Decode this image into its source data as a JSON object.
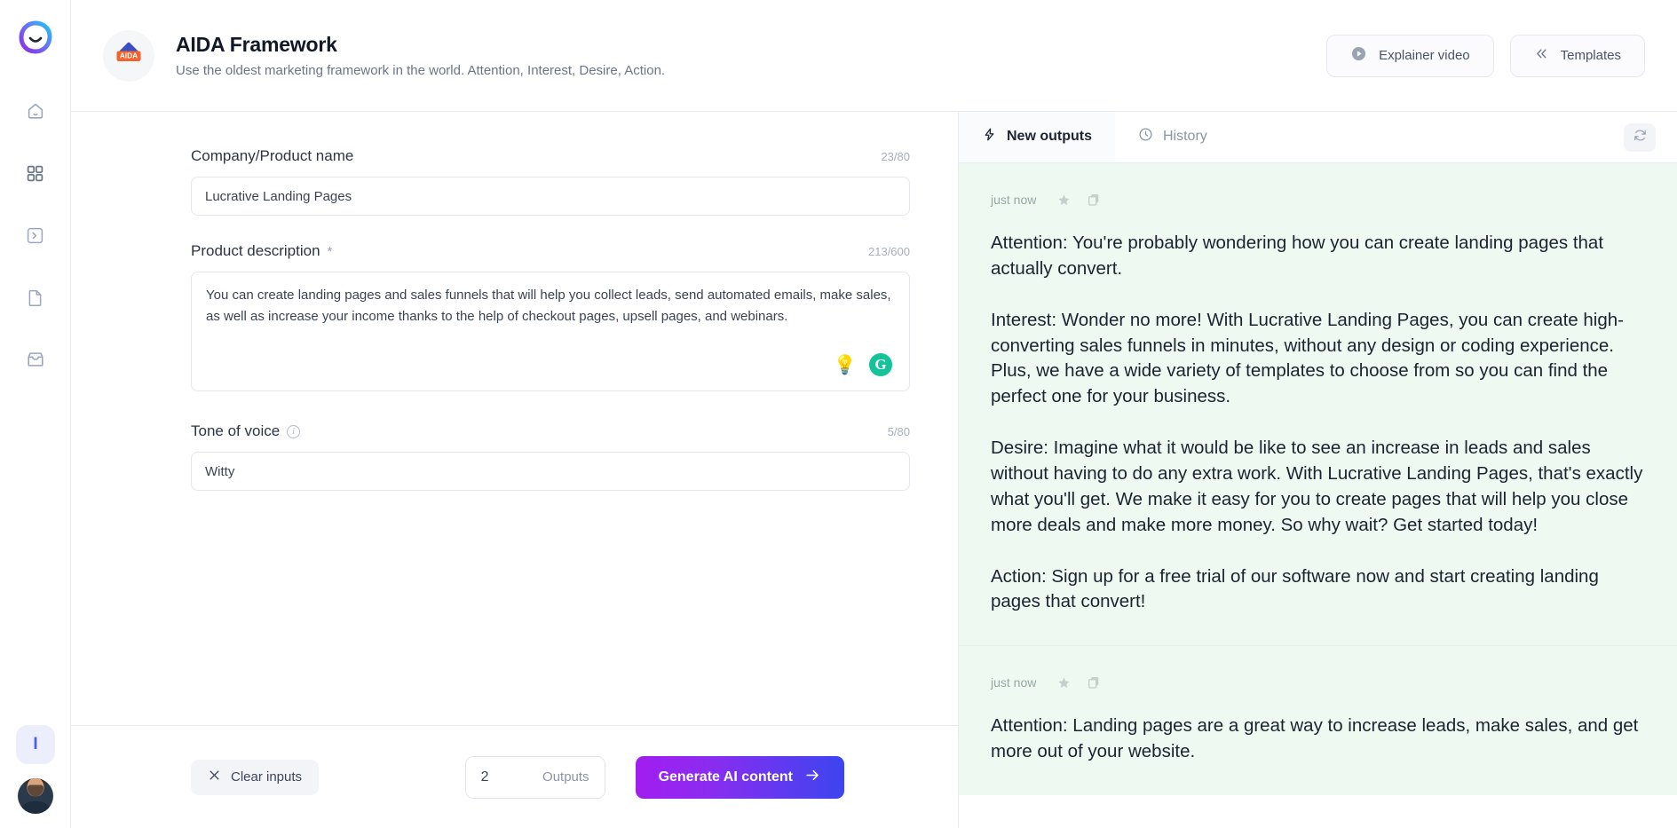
{
  "sidebar": {
    "logo_name": "app-logo",
    "items": [
      {
        "name": "home",
        "icon": "home-icon"
      },
      {
        "name": "apps",
        "icon": "grid-icon"
      },
      {
        "name": "console",
        "icon": "terminal-icon"
      },
      {
        "name": "documents",
        "icon": "document-icon"
      },
      {
        "name": "inbox",
        "icon": "inbox-icon"
      }
    ],
    "badge_label": "I",
    "avatar_name": "user-avatar"
  },
  "header": {
    "template_icon_label": "AIDA",
    "title": "AIDA Framework",
    "subtitle": "Use the oldest marketing framework in the world. Attention, Interest, Desire, Action.",
    "explainer_label": "Explainer video",
    "templates_label": "Templates"
  },
  "form": {
    "fields": [
      {
        "label": "Company/Product name",
        "required": false,
        "counter": "23/80",
        "value": "Lucrative Landing Pages",
        "placeholder": "Company/Product name"
      },
      {
        "label": "Product description",
        "required": true,
        "required_mark": "*",
        "counter": "213/600",
        "value": "You can create landing pages and sales funnels that will help you collect leads, send automated emails, make sales, as well as increase your income thanks to the help of checkout pages, upsell pages, and webinars.",
        "placeholder": "Product description"
      },
      {
        "label": "Tone of voice",
        "required": false,
        "has_info": true,
        "counter": "5/80",
        "value": "Witty",
        "placeholder": "Tone of voice"
      }
    ],
    "footer": {
      "clear_label": "Clear inputs",
      "outputs_count": "2",
      "outputs_label": "Outputs",
      "generate_label": "Generate AI content"
    }
  },
  "outputs": {
    "tabs": [
      {
        "label": "New outputs",
        "icon": "lightning-icon",
        "active": true
      },
      {
        "label": "History",
        "icon": "clock-icon",
        "active": false
      }
    ],
    "refresh_icon": "refresh-icon",
    "cards": [
      {
        "time": "just now",
        "text": "Attention: You're probably wondering how you can create landing pages that actually convert.\n\nInterest: Wonder no more! With Lucrative Landing Pages, you can create high-converting sales funnels in minutes, without any design or coding experience. Plus, we have a wide variety of templates to choose from so you can find the perfect one for your business.\n\nDesire: Imagine what it would be like to see an increase in leads and sales without having to do any extra work. With Lucrative Landing Pages, that's exactly what you'll get. We make it easy for you to create pages that will help you close more deals and make more money. So why wait? Get started today!\n\nAction: Sign up for a free trial of our software now and start creating landing pages that convert!"
      },
      {
        "time": "just now",
        "text": "Attention: Landing pages are a great way to increase leads, make sales, and get more out of your website."
      }
    ]
  },
  "colors": {
    "accent_purple": "#a21df0",
    "accent_blue": "#3b45ef",
    "output_bg": "#eefaf1",
    "grammarly_green": "#15c39a",
    "badge_blue": "#4b5bf5"
  }
}
